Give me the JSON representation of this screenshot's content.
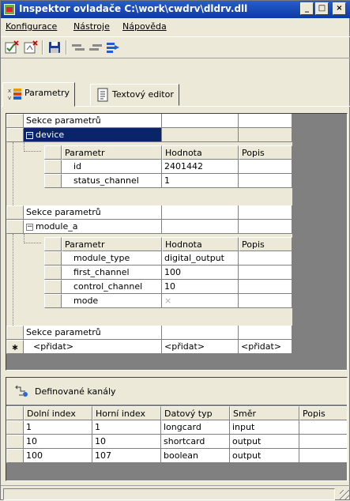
{
  "window": {
    "title": "Inspektor ovladače C:\\work\\cwdrv\\dldrv.dll",
    "btn_min": "_",
    "btn_max": "□",
    "btn_close": "×"
  },
  "menu": {
    "items": [
      {
        "label": "Konfigurace"
      },
      {
        "label": "Nástroje"
      },
      {
        "label": "Nápověda"
      }
    ]
  },
  "toolbar": {
    "icons": [
      "check-cross-icon",
      "document-cross-icon",
      "save-icon",
      "move-left-icon",
      "move-right-icon",
      "arrow-right-icon"
    ]
  },
  "tabs": [
    {
      "label": "Parametry",
      "icon": "parameters-icon"
    },
    {
      "label": "Textový editor",
      "icon": "text-editor-icon"
    }
  ],
  "grid": {
    "section_label": "Sekce parametrů",
    "sub_headers": {
      "parametr": "Parametr",
      "hodnota": "Hodnota",
      "popis": "Popis"
    },
    "sections": [
      {
        "name": "device",
        "expander": "⊟",
        "rows": [
          {
            "param": "id",
            "value": "2401442",
            "desc": ""
          },
          {
            "param": "status_channel",
            "value": "1",
            "desc": ""
          }
        ]
      },
      {
        "name": "module_a",
        "expander": "⊟",
        "rows": [
          {
            "param": "module_type",
            "value": "digital_output",
            "desc": ""
          },
          {
            "param": "first_channel",
            "value": "100",
            "desc": ""
          },
          {
            "param": "control_channel",
            "value": "10",
            "desc": ""
          },
          {
            "param": "mode",
            "value": "×",
            "desc": ""
          }
        ]
      }
    ],
    "new_row": {
      "marker": "∗",
      "add": "<přidat>"
    }
  },
  "channels": {
    "title": "Definované kanály",
    "columns": [
      "Dolní index",
      "Horní index",
      "Datový typ",
      "Směr",
      "Popis"
    ],
    "rows": [
      [
        "1",
        "1",
        "longcard",
        "input",
        ""
      ],
      [
        "10",
        "10",
        "shortcard",
        "output",
        ""
      ],
      [
        "100",
        "107",
        "boolean",
        "output",
        ""
      ]
    ]
  },
  "colors": {
    "title_bar": "#0B3AA5",
    "selection": "#0A246A",
    "face": "#ECE9D8"
  }
}
